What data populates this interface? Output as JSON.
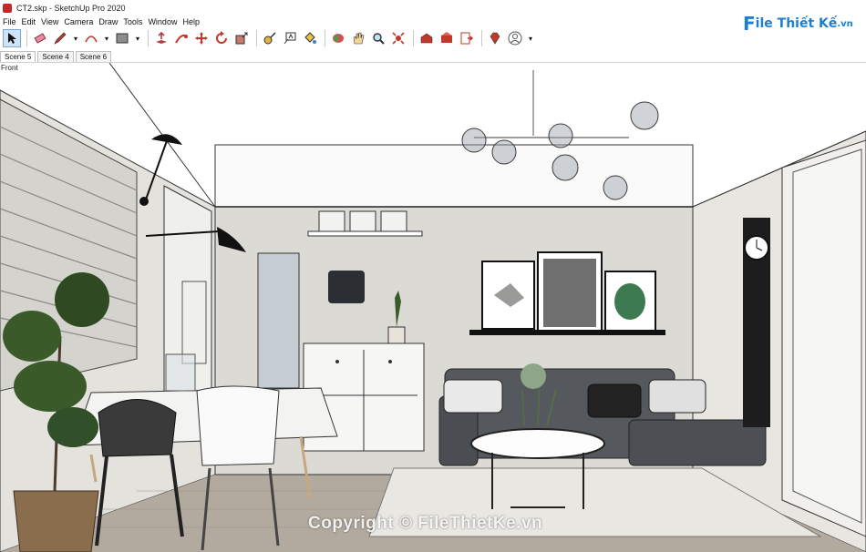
{
  "window": {
    "title": "CT2.skp - SketchUp Pro 2020"
  },
  "menu": [
    "File",
    "Edit",
    "View",
    "Camera",
    "Draw",
    "Tools",
    "Window",
    "Help"
  ],
  "toolbar": {
    "tools": [
      "select-tool",
      "eraser-tool",
      "pencil-line-tool",
      "arc-tool",
      "rectangle-shape-tool",
      "push-pull-tool",
      "follow-me-tool",
      "move-tool",
      "rotate-tool",
      "scale-offset-tool",
      "tape-measure-tool",
      "text-tool",
      "paint-bucket-tool",
      "orbit-tool",
      "pan-tool",
      "zoom-tool",
      "zoom-extents-tool",
      "3d-warehouse-tool",
      "extension-warehouse-tool",
      "layout-send-tool",
      "extension-manager-tool",
      "account-tool"
    ]
  },
  "scenes": {
    "tabs": [
      "Scene 5",
      "Scene 4",
      "Scene 6"
    ],
    "active": 0
  },
  "viewport": {
    "view_label": "Front"
  },
  "branding": {
    "logo_f": "F",
    "logo_rest": "ile Thiết Kế",
    "logo_tld": ".vn"
  },
  "watermark": "Copyright © FileThietKe.vn",
  "colors": {
    "accent": "#1b7fd3",
    "wall": "#dcdad5",
    "floor": "#b3aa9f",
    "sofa": "#55585c",
    "plant": "#3b5a2a"
  }
}
